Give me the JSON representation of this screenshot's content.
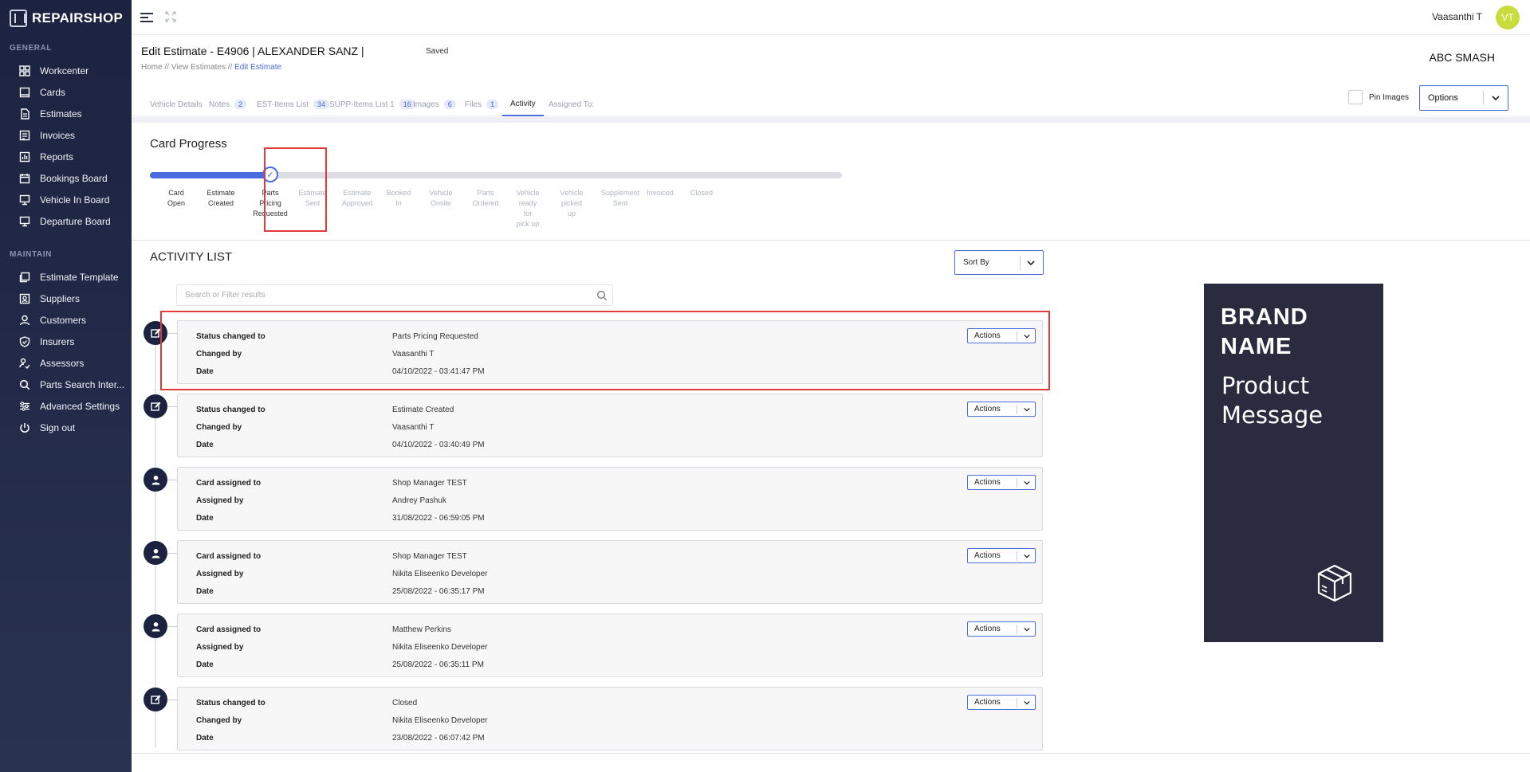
{
  "app": {
    "logo": "REPAIRSHOP"
  },
  "sidebar": {
    "general_label": "GENERAL",
    "maintain_label": "MAINTAIN",
    "general": [
      {
        "label": "Workcenter",
        "icon": "grid-icon"
      },
      {
        "label": "Cards",
        "icon": "card-icon"
      },
      {
        "label": "Estimates",
        "icon": "document-icon"
      },
      {
        "label": "Invoices",
        "icon": "invoice-icon"
      },
      {
        "label": "Reports",
        "icon": "report-icon"
      },
      {
        "label": "Bookings Board",
        "icon": "calendar-icon"
      },
      {
        "label": "Vehicle In Board",
        "icon": "board-icon"
      },
      {
        "label": "Departure Board",
        "icon": "board-icon"
      }
    ],
    "maintain": [
      {
        "label": "Estimate Template",
        "icon": "template-icon"
      },
      {
        "label": "Suppliers",
        "icon": "supplier-icon"
      },
      {
        "label": "Customers",
        "icon": "user-icon"
      },
      {
        "label": "Insurers",
        "icon": "shield-icon"
      },
      {
        "label": "Assessors",
        "icon": "assessor-icon"
      },
      {
        "label": "Parts Search Inter...",
        "icon": "search-icon"
      },
      {
        "label": "Advanced Settings",
        "icon": "sliders-icon"
      },
      {
        "label": "Sign out",
        "icon": "power-icon"
      }
    ]
  },
  "topbar": {
    "user_name": "Vaasanthi T",
    "avatar_initials": "VT",
    "avatar_color": "#c8dc3c"
  },
  "header": {
    "title": "Edit Estimate - E4906 | ALEXANDER SANZ |",
    "saved": "Saved",
    "breadcrumb": [
      "Home",
      "View Estimates",
      "Edit Estimate"
    ],
    "breadcrumb_sep": "//",
    "company": "ABC SMASH"
  },
  "tabs": [
    {
      "label": "Vehicle Details",
      "count": null
    },
    {
      "label": "Notes",
      "count": "2"
    },
    {
      "label": "EST-Items List",
      "count": "34"
    },
    {
      "label": "SUPP-Items List 1",
      "count": "16"
    },
    {
      "label": "Images",
      "count": "6"
    },
    {
      "label": "Files",
      "count": "1"
    },
    {
      "label": "Activity",
      "count": null,
      "active": true
    },
    {
      "label": "Assigned To:",
      "count": null
    }
  ],
  "pin_images": {
    "label": "Pin Images",
    "checked": false
  },
  "options": {
    "label": "Options"
  },
  "progress": {
    "title": "Card Progress",
    "current_index": 2,
    "steps": [
      [
        "Card",
        "Open"
      ],
      [
        "Estimate",
        "Created"
      ],
      [
        "Parts",
        "Pricing",
        "Requested"
      ],
      [
        "Estimate",
        "Sent"
      ],
      [
        "Estimate",
        "Approved"
      ],
      [
        "Booked",
        "In"
      ],
      [
        "Vehicle",
        "Onsite"
      ],
      [
        "Parts",
        "Ordered"
      ],
      [
        "Vehicle",
        "ready",
        "for",
        "pick up"
      ],
      [
        "Vehicle",
        "picked",
        "up"
      ],
      [
        "Supplement",
        "Sent"
      ],
      [
        "Invoiced"
      ],
      [
        "Closed"
      ]
    ]
  },
  "activity": {
    "title": "ACTIVITY LIST",
    "sort_label": "Sort By",
    "search_placeholder": "Search or Filter results",
    "actions_label": "Actions",
    "items": [
      {
        "type": "status",
        "rows": [
          [
            "Status changed to",
            "Parts Pricing Requested"
          ],
          [
            "Changed by",
            "Vaasanthi T"
          ],
          [
            "Date",
            "04/10/2022 - 03:41:47 PM"
          ]
        ]
      },
      {
        "type": "status",
        "rows": [
          [
            "Status changed to",
            "Estimate Created"
          ],
          [
            "Changed by",
            "Vaasanthi T"
          ],
          [
            "Date",
            "04/10/2022 - 03:40:49 PM"
          ]
        ]
      },
      {
        "type": "assign",
        "rows": [
          [
            "Card assigned to",
            "Shop Manager TEST"
          ],
          [
            "Assigned by",
            "Andrey Pashuk"
          ],
          [
            "Date",
            "31/08/2022 - 06:59:05 PM"
          ]
        ]
      },
      {
        "type": "assign",
        "rows": [
          [
            "Card assigned to",
            "Shop Manager TEST"
          ],
          [
            "Assigned by",
            "Nikita Eliseenko Developer"
          ],
          [
            "Date",
            "25/08/2022 - 06:35:17 PM"
          ]
        ]
      },
      {
        "type": "assign",
        "rows": [
          [
            "Card assigned to",
            "Matthew Perkins"
          ],
          [
            "Assigned by",
            "Nikita Eliseenko Developer"
          ],
          [
            "Date",
            "25/08/2022 - 06:35:11 PM"
          ]
        ]
      },
      {
        "type": "status",
        "rows": [
          [
            "Status changed to",
            "Closed"
          ],
          [
            "Changed by",
            "Nikita Eliseenko Developer"
          ],
          [
            "Date",
            "23/08/2022 - 06:07:42 PM"
          ]
        ]
      }
    ]
  },
  "ad": {
    "brand": [
      "BRAND",
      "NAME"
    ],
    "message": [
      "Product",
      "Message"
    ],
    "icon": "box-icon"
  },
  "colors": {
    "accent": "#4a6be0",
    "sidebar": "#1c2340",
    "highlight": "#e03a3a",
    "ad_bg": "#2b2b40"
  }
}
